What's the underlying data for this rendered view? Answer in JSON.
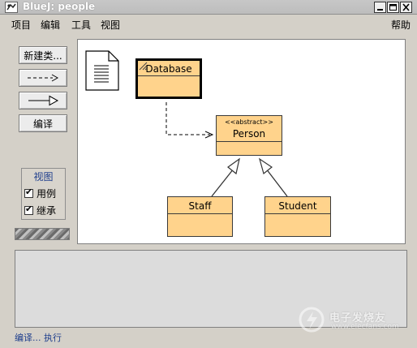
{
  "window": {
    "title": "BlueJ:  people",
    "controls": [
      "minimize-icon",
      "maximize-icon",
      "close-icon"
    ]
  },
  "menubar": {
    "items": [
      "项目",
      "编辑",
      "工具",
      "视图"
    ],
    "help": "帮助"
  },
  "tools": {
    "new_class": "新建类...",
    "dashed_arrow": "--->",
    "solid_arrow": "—▷",
    "compile": "编译"
  },
  "view_panel": {
    "title": "视图",
    "options": [
      {
        "label": "用例",
        "checked": true
      },
      {
        "label": "继承",
        "checked": true
      }
    ]
  },
  "diagram": {
    "note_icon": "document-icon",
    "classes": [
      {
        "id": "database",
        "name": "Database",
        "selected": true
      },
      {
        "id": "person",
        "name": "Person",
        "stereotype": "<<abstract>>"
      },
      {
        "id": "staff",
        "name": "Staff"
      },
      {
        "id": "student",
        "name": "Student"
      }
    ],
    "relations": [
      {
        "from": "Database",
        "to": "Person",
        "kind": "uses"
      },
      {
        "from": "Staff",
        "to": "Person",
        "kind": "inherits"
      },
      {
        "from": "Student",
        "to": "Person",
        "kind": "inherits"
      }
    ]
  },
  "status_bar": {
    "text": "编译... 执行"
  },
  "watermark": {
    "main": "电子发烧友",
    "sub": "www.elecfans.com"
  },
  "colors": {
    "class_fill": "#ffd38c",
    "background": "#d4d0c8",
    "canvas": "#ffffff",
    "status_text": "#1d3d8c"
  }
}
